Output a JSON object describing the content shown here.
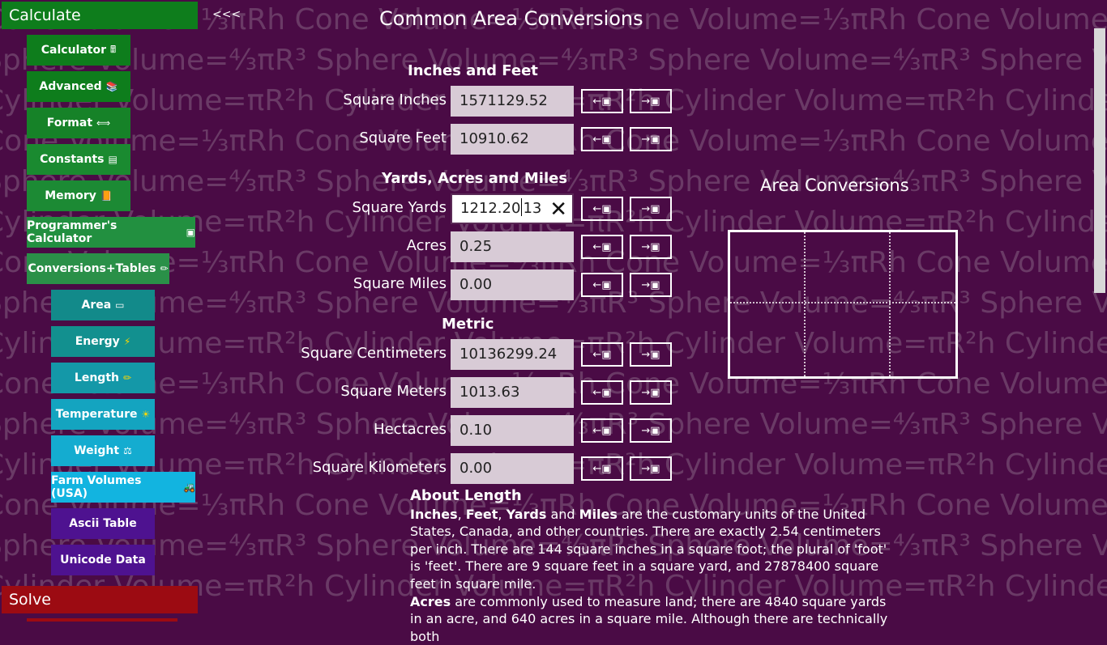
{
  "watermark": {
    "lines": [
      "Cone Volume=⅓πRh",
      "Sphere Volume=⁴⁄₃πR³",
      "Cylinder Volume=πR²h"
    ]
  },
  "sidebar": {
    "calculate_header": "Calculate",
    "collapse_label": "<<<",
    "solve_header": "Solve",
    "items": [
      {
        "label": "Calculator",
        "icon": "🖩"
      },
      {
        "label": "Advanced",
        "icon": "📚"
      },
      {
        "label": "Format",
        "icon": "⟺"
      },
      {
        "label": "Constants",
        "icon": "▤"
      },
      {
        "label": "Memory",
        "icon": "📙"
      },
      {
        "label": "Programmer's Calculator",
        "icon": "▣"
      },
      {
        "label": "Conversions+Tables",
        "icon": "✏"
      }
    ],
    "subitems": [
      {
        "label": "Area",
        "icon": "▭"
      },
      {
        "label": "Energy",
        "icon": "⚡"
      },
      {
        "label": "Length",
        "icon": "✏"
      },
      {
        "label": "Temperature",
        "icon": "☀"
      },
      {
        "label": "Weight",
        "icon": "⚖"
      },
      {
        "label": "Farm Volumes (USA)",
        "icon": "🚜"
      },
      {
        "label": "Ascii Table",
        "icon": ""
      },
      {
        "label": "Unicode Data",
        "icon": ""
      }
    ]
  },
  "main": {
    "title": "Common Area Conversions",
    "sections": [
      {
        "title": "Inches and Feet"
      },
      {
        "title": "Yards, Acres and Miles"
      },
      {
        "title": "Metric"
      }
    ],
    "rows": [
      {
        "label": "Square Inches",
        "value": "1571129.52"
      },
      {
        "label": "Square Feet",
        "value": "10910.62"
      },
      {
        "label": "Square Yards",
        "value_before_caret": "1212.20",
        "value_after_caret": "13"
      },
      {
        "label": "Acres",
        "value": "0.25"
      },
      {
        "label": "Square Miles",
        "value": "0.00"
      },
      {
        "label": "Square Centimeters",
        "value": "10136299.24"
      },
      {
        "label": "Square Meters",
        "value": "1013.63"
      },
      {
        "label": "Hectacres",
        "value": "0.10"
      },
      {
        "label": "Square Kilometers",
        "value": "0.00"
      }
    ],
    "arrow_left": "←▣",
    "arrow_right": "→▣",
    "clear_glyph": "✕"
  },
  "diagram": {
    "title": "Area Conversions"
  },
  "about": {
    "title": "About Length",
    "p1": {
      "b1": "Inches",
      "t1": ", ",
      "b2": "Feet",
      "t2": ", ",
      "b3": "Yards",
      "t3": " and ",
      "b4": "Miles",
      "t4": " are the customary units of the United States, Canada, and other countries. There are exactly 2.54 centimeters per inch. There are 144 square inches in a square foot; the plural of 'foot' is 'feet'. There are 9 square feet in a square yard, and 27878400 square feet in square mile."
    },
    "p2": {
      "b1": "Acres",
      "t1": " are commonly used to measure land; there are 4840 square yards in an acre, and 640 acres in a square mile. Although there are technically both"
    }
  }
}
